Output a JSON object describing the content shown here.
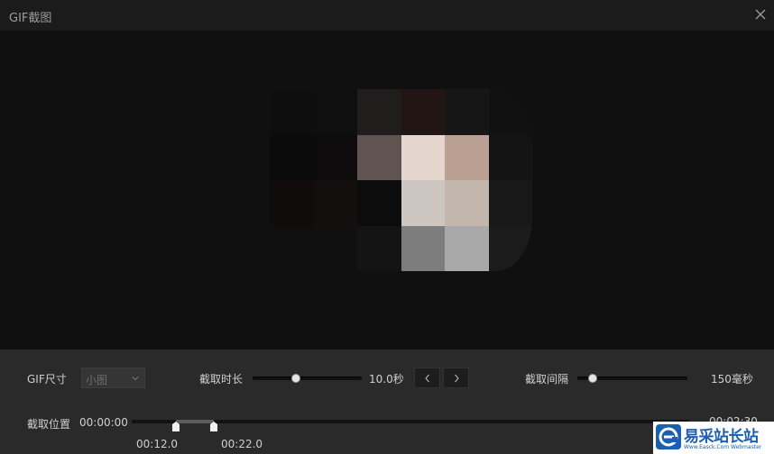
{
  "window": {
    "title": "GIF截图",
    "close_icon": "close-icon"
  },
  "preview": {
    "description_colors": [
      [
        "#0e0e0e",
        "#0f0f0f",
        "#1f1e1d",
        "#221615",
        "#161616",
        "#111111"
      ],
      [
        "#0c0b0b",
        "#0d0b0b",
        "#5f5452",
        "#e4d6cc",
        "#b9a093",
        "#141414"
      ],
      [
        "#110c0c",
        "#130f0f",
        "#0c0c0c",
        "#ccc5c0",
        "#c3b7ad",
        "#181818"
      ],
      [
        "#0f0f0f",
        "#101010",
        "#141414",
        "#7d7d7d",
        "#a9a9a9",
        "#1b1b1b"
      ]
    ]
  },
  "controls": {
    "gif_size_label": "GIF尺寸",
    "gif_size_value": "小图",
    "duration_label": "截取时长",
    "duration_value": "10.0秒",
    "duration_level": 0.4,
    "interval_label": "截取间隔",
    "interval_value": "150毫秒",
    "interval_level": 0.14,
    "position_label": "截取位置",
    "start_time": "00:00:00",
    "end_time": "00:02:30",
    "marker_start": "00:12.0",
    "marker_end": "00:22.0",
    "marker_start_seconds": 12.0,
    "marker_end_seconds": 22.0,
    "total_seconds": 150
  },
  "watermark": {
    "text": "易采站长站",
    "sub": "Www.Easck.Com Webmaster"
  },
  "colors": {
    "titlebar": "#1b1b1b",
    "preview_bg": "#101010",
    "controls_bg": "#2a2a2a",
    "watermark_blue": "#1a5fb4"
  }
}
